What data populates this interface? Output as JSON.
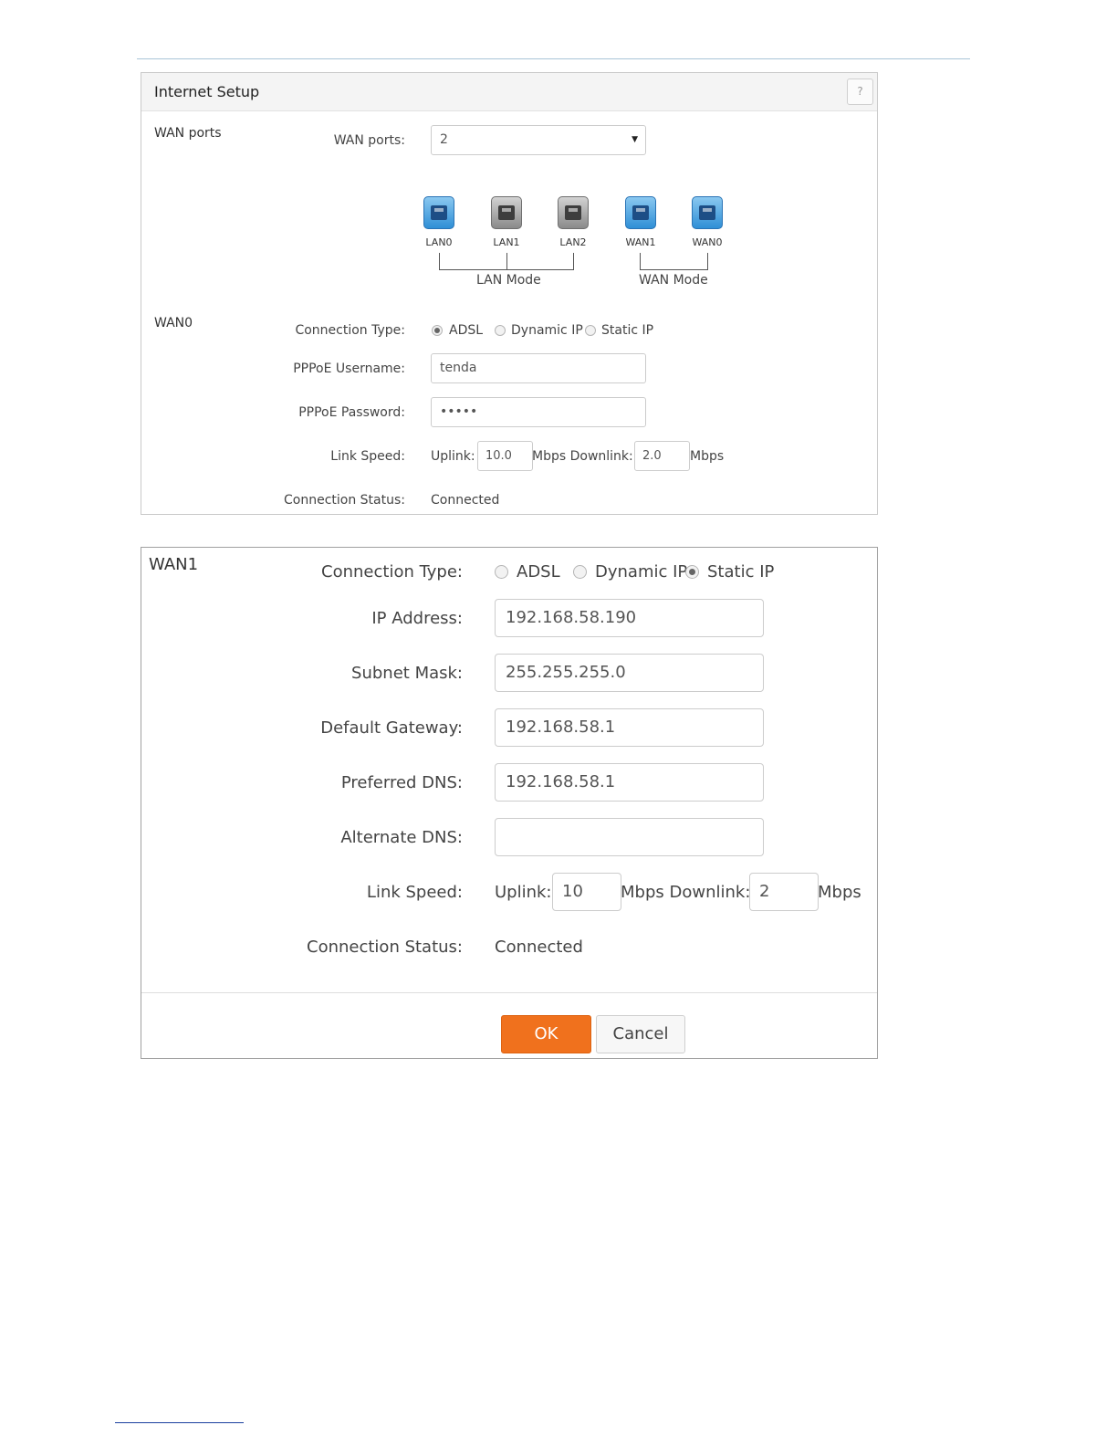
{
  "panel1": {
    "title": "Internet Setup",
    "help_label": "?",
    "wan_ports_section": "WAN ports",
    "wan_ports_label": "WAN ports:",
    "wan_ports_value": "2",
    "ports": [
      {
        "label": "LAN0",
        "color": "blue"
      },
      {
        "label": "LAN1",
        "color": "gray"
      },
      {
        "label": "LAN2",
        "color": "gray"
      },
      {
        "label": "WAN1",
        "color": "blue"
      },
      {
        "label": "WAN0",
        "color": "blue"
      }
    ],
    "lan_mode_label": "LAN Mode",
    "wan_mode_label": "WAN Mode",
    "wan0_section": "WAN0",
    "connection_type_label": "Connection Type:",
    "connection_types": [
      "ADSL",
      "Dynamic IP",
      "Static IP"
    ],
    "connection_type_selected": "ADSL",
    "pppoe_username_label": "PPPoE Username:",
    "pppoe_username_value": "tenda",
    "pppoe_password_label": "PPPoE Password:",
    "pppoe_password_value": "•••••",
    "link_speed_label": "Link Speed:",
    "uplink_label": "Uplink:",
    "uplink_value": "10.0",
    "mbps_downlink_label": "Mbps Downlink:",
    "downlink_value": "2.0",
    "mbps_label": "Mbps",
    "connection_status_label": "Connection Status:",
    "connection_status_value": "Connected"
  },
  "panel2": {
    "wan1_section": "WAN1",
    "connection_type_label": "Connection Type:",
    "connection_types": [
      "ADSL",
      "Dynamic IP",
      "Static IP"
    ],
    "connection_type_selected": "Static IP",
    "ip_address_label": "IP Address:",
    "ip_address_value": "192.168.58.190",
    "subnet_mask_label": "Subnet Mask:",
    "subnet_mask_value": "255.255.255.0",
    "default_gateway_label": "Default Gateway:",
    "default_gateway_value": "192.168.58.1",
    "preferred_dns_label": "Preferred DNS:",
    "preferred_dns_value": "192.168.58.1",
    "alternate_dns_label": "Alternate DNS:",
    "alternate_dns_value": "",
    "link_speed_label": "Link Speed:",
    "uplink_label": "Uplink:",
    "uplink_value": "10",
    "mbps_downlink_label": "Mbps Downlink:",
    "downlink_value": "2",
    "mbps_label": "Mbps",
    "connection_status_label": "Connection Status:",
    "connection_status_value": "Connected",
    "ok_label": "OK",
    "cancel_label": "Cancel"
  },
  "colors": {
    "accent_orange": "#f0711d",
    "port_active_blue": "#2f8fd6",
    "port_inactive_gray": "#8a8a8a",
    "rule_blue": "#a9c4d8"
  }
}
